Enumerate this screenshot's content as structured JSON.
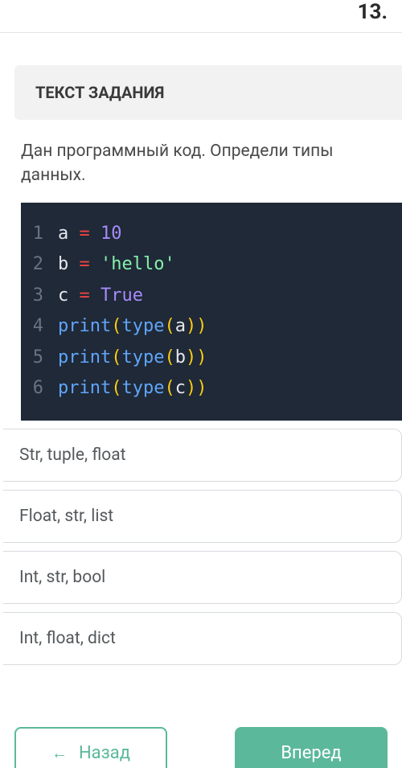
{
  "header": {
    "left_fragment": "",
    "right_fragment": "13."
  },
  "section_title": "ТЕКСТ ЗАДАНИЯ",
  "question_text": "Дан программный код. Определи типы данных.",
  "code": {
    "lines": [
      {
        "n": "1",
        "tokens": [
          {
            "t": "a ",
            "c": "tk-var"
          },
          {
            "t": "=",
            "c": "tk-op"
          },
          {
            "t": " ",
            "c": "tk-var"
          },
          {
            "t": "10",
            "c": "tk-num"
          }
        ]
      },
      {
        "n": "2",
        "tokens": [
          {
            "t": "b ",
            "c": "tk-var"
          },
          {
            "t": "=",
            "c": "tk-op"
          },
          {
            "t": " ",
            "c": "tk-var"
          },
          {
            "t": "'hello'",
            "c": "tk-str"
          }
        ]
      },
      {
        "n": "3",
        "tokens": [
          {
            "t": "c ",
            "c": "tk-var"
          },
          {
            "t": "=",
            "c": "tk-op"
          },
          {
            "t": " ",
            "c": "tk-var"
          },
          {
            "t": "True",
            "c": "tk-bool"
          }
        ]
      },
      {
        "n": "4",
        "tokens": [
          {
            "t": "print",
            "c": "tk-fn"
          },
          {
            "t": "(",
            "c": "tk-par"
          },
          {
            "t": "type",
            "c": "tk-fn"
          },
          {
            "t": "(",
            "c": "tk-par"
          },
          {
            "t": "a",
            "c": "tk-var"
          },
          {
            "t": ")",
            "c": "tk-par"
          },
          {
            "t": ")",
            "c": "tk-par"
          }
        ]
      },
      {
        "n": "5",
        "tokens": [
          {
            "t": "print",
            "c": "tk-fn"
          },
          {
            "t": "(",
            "c": "tk-par"
          },
          {
            "t": "type",
            "c": "tk-fn"
          },
          {
            "t": "(",
            "c": "tk-par"
          },
          {
            "t": "b",
            "c": "tk-var"
          },
          {
            "t": ")",
            "c": "tk-par"
          },
          {
            "t": ")",
            "c": "tk-par"
          }
        ]
      },
      {
        "n": "6",
        "tokens": [
          {
            "t": "print",
            "c": "tk-fn"
          },
          {
            "t": "(",
            "c": "tk-par"
          },
          {
            "t": "type",
            "c": "tk-fn"
          },
          {
            "t": "(",
            "c": "tk-par"
          },
          {
            "t": "c",
            "c": "tk-var"
          },
          {
            "t": ")",
            "c": "tk-par"
          },
          {
            "t": ")",
            "c": "tk-par"
          }
        ]
      }
    ]
  },
  "options": [
    "Str, tuple, float",
    "Float, str, list",
    "Int, str, bool",
    "Int, float, dict"
  ],
  "nav": {
    "back": "Назад",
    "forward": "Вперед",
    "arrow_left": "←"
  }
}
